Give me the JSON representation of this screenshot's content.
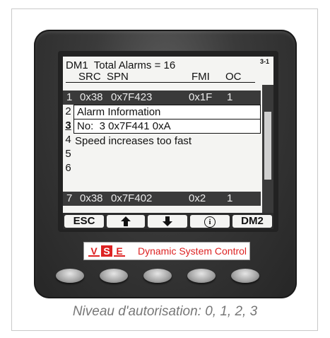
{
  "display": {
    "title": "DM1  Total Alarms = 16",
    "page_indicator": "3-1",
    "columns": {
      "src": "SRC",
      "spn": "SPN",
      "fmi": "FMI",
      "oc": "OC"
    },
    "row_numbers": [
      "1",
      "2",
      "3",
      "4",
      "5",
      "6",
      "7"
    ],
    "row1": {
      "src": "0x38",
      "spn": "0x7F423",
      "fmi": "0x1F",
      "oc": "1"
    },
    "popup": {
      "title": "Alarm Information",
      "detail": "No:  3 0x7F441 0xA",
      "description": "Speed increases too fast"
    },
    "row7": {
      "src": "0x38",
      "spn": "0x7F402",
      "fmi": "0x2",
      "oc": "1"
    },
    "scroll_position": 0.45
  },
  "softkeys": {
    "esc": "ESC",
    "up": "arrow-up-icon",
    "down": "arrow-down-icon",
    "info": "i",
    "dm2": "DM2"
  },
  "brand": {
    "logo_letters": [
      "V",
      "S",
      "E"
    ],
    "name": "Dynamic System Control",
    "color": "#d22222"
  },
  "caption": "Niveau d'autorisation: 0, 1, 2, 3"
}
